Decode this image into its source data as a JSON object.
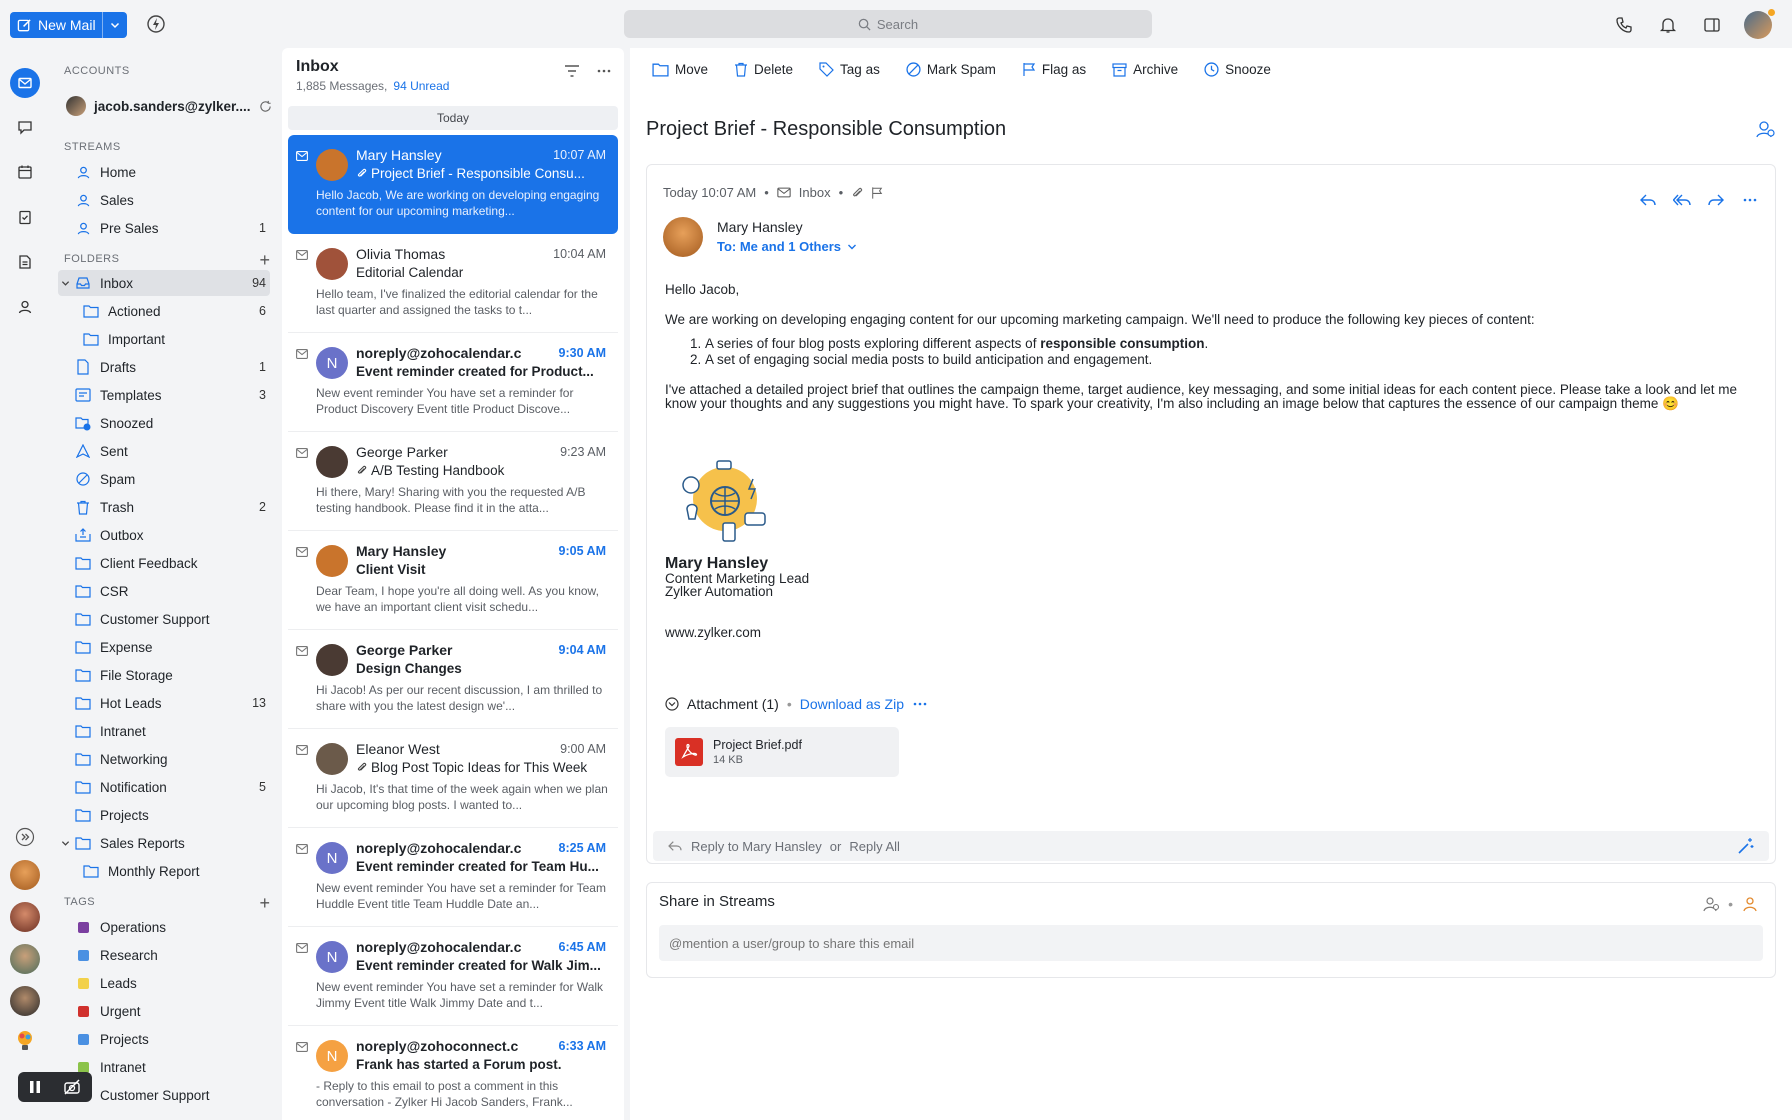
{
  "topbar": {
    "new_mail_label": "New Mail",
    "search_placeholder": "Search"
  },
  "sidebar": {
    "accounts_heading": "ACCOUNTS",
    "account_email": "jacob.sanders@zylker....",
    "streams_heading": "STREAMS",
    "streams": [
      {
        "label": "Home",
        "count": ""
      },
      {
        "label": "Sales",
        "count": ""
      },
      {
        "label": "Pre Sales",
        "count": "1"
      }
    ],
    "folders_heading": "FOLDERS",
    "folders": [
      {
        "label": "Inbox",
        "count": "94"
      },
      {
        "label": "Actioned",
        "count": "6"
      },
      {
        "label": "Important",
        "count": ""
      },
      {
        "label": "Drafts",
        "count": "1"
      },
      {
        "label": "Templates",
        "count": "3"
      },
      {
        "label": "Snoozed",
        "count": ""
      },
      {
        "label": "Sent",
        "count": ""
      },
      {
        "label": "Spam",
        "count": ""
      },
      {
        "label": "Trash",
        "count": "2"
      },
      {
        "label": "Outbox",
        "count": ""
      },
      {
        "label": "Client Feedback",
        "count": ""
      },
      {
        "label": "CSR",
        "count": ""
      },
      {
        "label": "Customer Support",
        "count": ""
      },
      {
        "label": "Expense",
        "count": ""
      },
      {
        "label": "File Storage",
        "count": ""
      },
      {
        "label": "Hot Leads",
        "count": "13"
      },
      {
        "label": "Intranet",
        "count": ""
      },
      {
        "label": "Networking",
        "count": ""
      },
      {
        "label": "Notification",
        "count": "5"
      },
      {
        "label": "Projects",
        "count": ""
      },
      {
        "label": "Sales Reports",
        "count": ""
      },
      {
        "label": "Monthly Report",
        "count": ""
      }
    ],
    "tags_heading": "TAGS",
    "tags": [
      {
        "label": "Operations",
        "color": "#7b3fa0"
      },
      {
        "label": "Research",
        "color": "#4a90e2"
      },
      {
        "label": "Leads",
        "color": "#f2d14b"
      },
      {
        "label": "Urgent",
        "color": "#d0312d"
      },
      {
        "label": "Projects",
        "color": "#4a90e2"
      },
      {
        "label": "Intranet",
        "color": "#8bc34a"
      },
      {
        "label": "Customer Support",
        "color": "#2f80ed"
      }
    ]
  },
  "list": {
    "title": "Inbox",
    "messages_count": "1,885 Messages,",
    "unread_count": "94 Unread",
    "day_label": "Today",
    "messages": [
      {
        "from": "Mary Hansley",
        "time": "10:07 AM",
        "subject": "Project Brief - Responsible Consu...",
        "preview": "Hello Jacob, We are working on developing engaging content for our upcoming marketing...",
        "initial": "",
        "avatar_color": "#c9742c",
        "attach": true
      },
      {
        "from": "Olivia Thomas",
        "time": "10:04 AM",
        "subject": "Editorial Calendar",
        "preview": "Hello team, I've finalized the editorial calendar for the last quarter and assigned the tasks to t...",
        "initial": "",
        "avatar_color": "#a0523a",
        "attach": false
      },
      {
        "from": "noreply@zohocalendar.c",
        "time": "9:30 AM",
        "subject": "Event reminder created for Product...",
        "preview": "New event reminder You have set a reminder for Product Discovery Event title Product Discove...",
        "initial": "N",
        "avatar_color": "#6a72c9",
        "attach": false
      },
      {
        "from": "George Parker",
        "time": "9:23 AM",
        "subject": "A/B Testing Handbook",
        "preview": "Hi there, Mary! Sharing with you the requested A/B testing handbook. Please find it in the atta...",
        "initial": "",
        "avatar_color": "#4a3a33",
        "attach": true
      },
      {
        "from": "Mary Hansley",
        "time": "9:05 AM",
        "subject": "Client Visit",
        "preview": "Dear Team, I hope you're all doing well. As you know, we have an important client visit schedu...",
        "initial": "",
        "avatar_color": "#c9742c",
        "attach": false
      },
      {
        "from": "George Parker",
        "time": "9:04 AM",
        "subject": "Design Changes",
        "preview": "Hi Jacob! As per our recent discussion, I am thrilled to share with you the latest design we'...",
        "initial": "",
        "avatar_color": "#4a3a33",
        "attach": false
      },
      {
        "from": "Eleanor West",
        "time": "9:00 AM",
        "subject": "Blog Post Topic Ideas for This Week",
        "preview": "Hi Jacob, It's that time of the week again when we plan our upcoming blog posts. I wanted to...",
        "initial": "",
        "avatar_color": "#6b5a4a",
        "attach": true
      },
      {
        "from": "noreply@zohocalendar.c",
        "time": "8:25 AM",
        "subject": "Event reminder created for Team Hu...",
        "preview": "New event reminder You have set a reminder for Team Huddle Event title Team Huddle Date an...",
        "initial": "N",
        "avatar_color": "#6a72c9",
        "attach": false
      },
      {
        "from": "noreply@zohocalendar.c",
        "time": "6:45 AM",
        "subject": "Event reminder created for Walk Jim...",
        "preview": "New event reminder You have set a reminder for Walk Jimmy Event title Walk Jimmy Date and t...",
        "initial": "N",
        "avatar_color": "#6a72c9",
        "attach": false
      },
      {
        "from": "noreply@zohoconnect.c",
        "time": "6:33 AM",
        "subject": "Frank has started a Forum post.",
        "preview": "- Reply to this email to post a comment in this conversation - Zylker Hi Jacob Sanders, Frank...",
        "initial": "N",
        "avatar_color": "#f5a142",
        "attach": false
      }
    ]
  },
  "toolbar": {
    "move": "Move",
    "delete": "Delete",
    "tag_as": "Tag as",
    "mark_spam": "Mark Spam",
    "flag_as": "Flag as",
    "archive": "Archive",
    "snooze": "Snooze"
  },
  "email": {
    "subject": "Project Brief - Responsible Consumption",
    "date": "Today 10:07 AM",
    "folder": "Inbox",
    "sender": "Mary Hansley",
    "to": "To: Me and 1 Others",
    "greeting": "Hello Jacob,",
    "intro": "We are working on developing engaging content for our upcoming marketing campaign. We'll need to produce the following key pieces of content:",
    "item1_a": "A series of four blog posts exploring different aspects of ",
    "item1_b": "responsible consumption",
    "item1_c": ".",
    "item2": "A set of engaging social media posts to build anticipation and engagement.",
    "para2": "I've attached a detailed project brief that outlines the campaign theme, target audience, key messaging, and some initial ideas for each content piece. Please take a look and let me know your thoughts and any suggestions you might have. To spark your creativity, I'm also including an image below that captures the essence of our campaign theme 😊",
    "sig_name": "Mary Hansley",
    "sig_title": "Content Marketing Lead",
    "sig_company": "Zylker Automation",
    "website": "www.zylker.com",
    "attachment_heading": "Attachment (1)",
    "download_zip": "Download as Zip",
    "file_name": "Project Brief.pdf",
    "file_size": "14 KB",
    "reply_to": "Reply to Mary Hansley",
    "reply_or": "or",
    "reply_all": "Reply All"
  },
  "streams_share": {
    "title": "Share in Streams",
    "placeholder": "@mention a user/group to share this email"
  }
}
